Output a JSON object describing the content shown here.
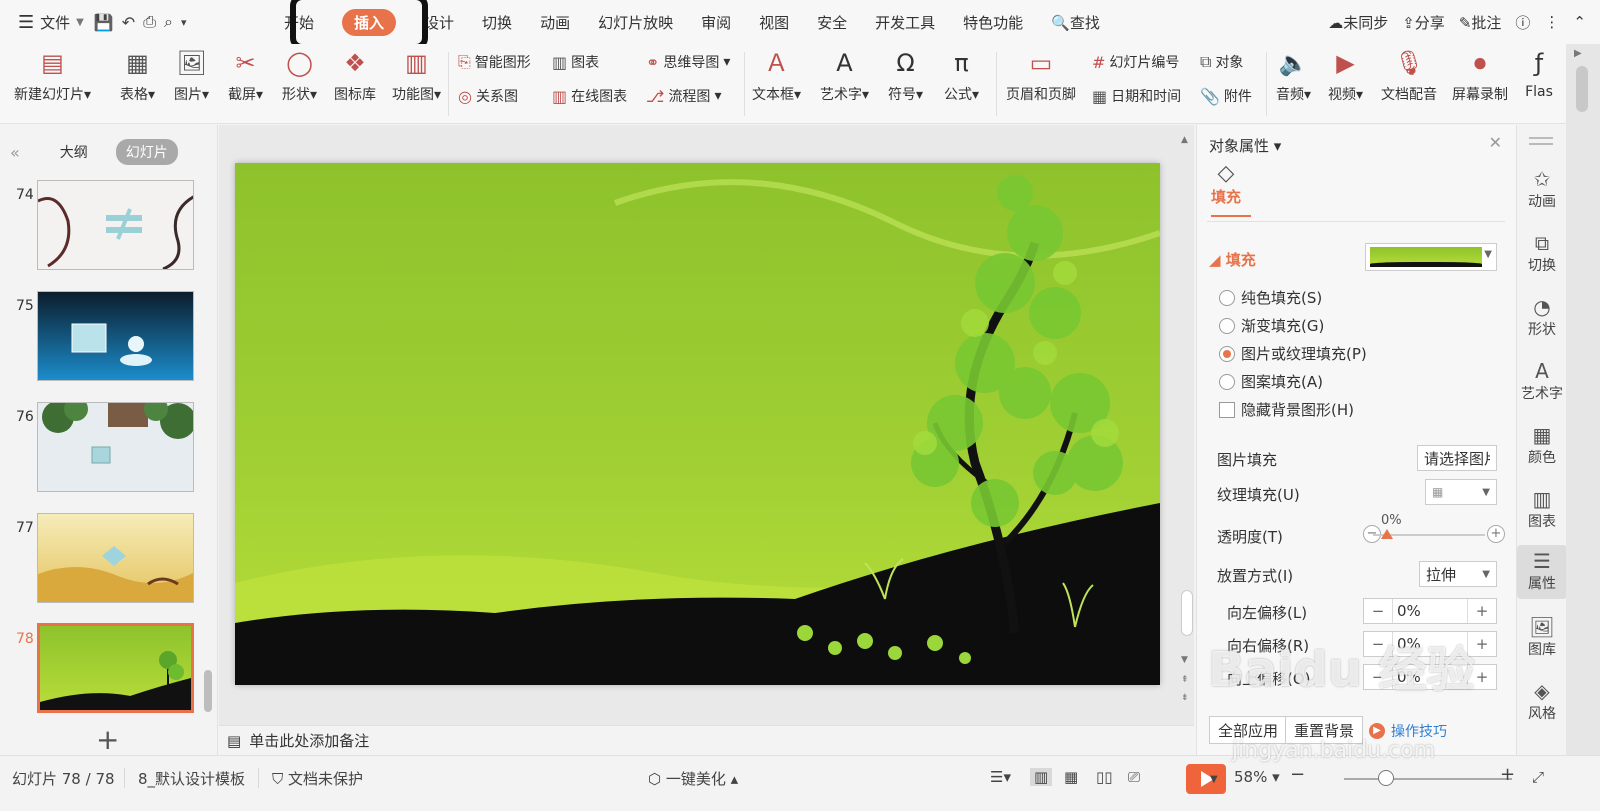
{
  "menubar": {
    "file_label": "文件",
    "tabs": [
      "开始",
      "插入",
      "设计",
      "切换",
      "动画",
      "幻灯片放映",
      "审阅",
      "视图",
      "安全",
      "开发工具",
      "特色功能"
    ],
    "active_tab": "插入",
    "search_label": "查找",
    "sync_label": "未同步",
    "share_label": "分享",
    "comment_label": "批注"
  },
  "ribbon": {
    "new_slide": "新建幻灯片",
    "table": "表格",
    "picture": "图片",
    "screenshot": "截屏",
    "shape": "形状",
    "icon_lib": "图标库",
    "function_chart": "功能图",
    "smart_art": "智能图形",
    "chart": "图表",
    "mind_map": "思维导图",
    "relation": "关系图",
    "online_chart": "在线图表",
    "flowchart": "流程图",
    "textbox": "文本框",
    "wordart": "艺术字",
    "symbol": "符号",
    "formula": "公式",
    "header_footer": "页眉和页脚",
    "slide_number": "幻灯片编号",
    "object": "对象",
    "date_time": "日期和时间",
    "attachment": "附件",
    "audio": "音频",
    "video": "视频",
    "doc_dub": "文档配音",
    "screen_record": "屏幕录制",
    "flash": "Flas"
  },
  "left_panel": {
    "tab_outline": "大纲",
    "tab_slides": "幻灯片",
    "slides": [
      {
        "num": "74"
      },
      {
        "num": "75"
      },
      {
        "num": "76"
      },
      {
        "num": "77"
      },
      {
        "num": "78"
      }
    ],
    "selected": "78"
  },
  "notes_placeholder": "单击此处添加备注",
  "properties": {
    "title": "对象属性",
    "tab_fill": "填充",
    "section_fill": "填充",
    "options": [
      "纯色填充(S)",
      "渐变填充(G)",
      "图片或纹理填充(P)",
      "图案填充(A)"
    ],
    "selected_option": "图片或纹理填充(P)",
    "hide_bg_label": "隐藏背景图形(H)",
    "picture_fill_label": "图片填充",
    "picture_fill_button": "请选择图片",
    "texture_fill_label": "纹理填充(U)",
    "transparency_label": "透明度(T)",
    "transparency_value": "0%",
    "placement_label": "放置方式(I)",
    "placement_value": "拉伸",
    "offset_left_label": "向左偏移(L)",
    "offset_left_value": "0%",
    "offset_right_label": "向右偏移(R)",
    "offset_right_value": "0%",
    "offset_up_label": "向上偏移(O)",
    "offset_up_value": "0%",
    "apply_all": "全部应用",
    "reset_bg": "重置背景",
    "tips": "操作技巧"
  },
  "sidebar": [
    "动画",
    "切换",
    "形状",
    "艺术字",
    "颜色",
    "图表",
    "属性",
    "图库",
    "风格"
  ],
  "sidebar_active": "属性",
  "statusbar": {
    "slide_count": "幻灯片 78 / 78",
    "template": "8_默认设计模板",
    "protection": "文档未保护",
    "beautify": "一键美化",
    "zoom": "58%"
  },
  "watermark": {
    "text": "Baidu 经验",
    "url": "jingyan.baidu.com"
  },
  "colors": {
    "accent": "#e8734a",
    "slide_green": "#9fcf33",
    "play": "#f0643c"
  }
}
